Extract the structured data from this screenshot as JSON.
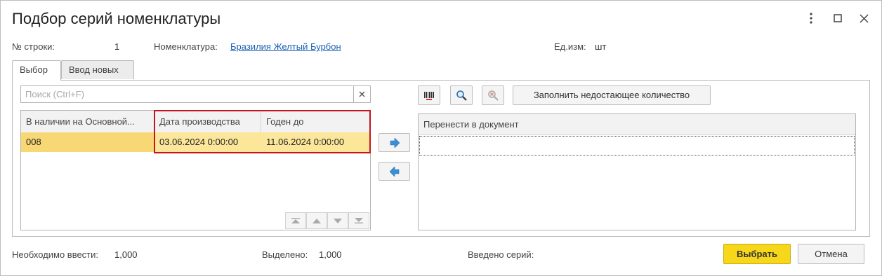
{
  "window": {
    "title": "Подбор серий номенклатуры",
    "menu_icon": "more-vertical-icon",
    "maximize_icon": "maximize-icon",
    "close_icon": "close-icon"
  },
  "header": {
    "row_label": "№ строки:",
    "row_value": "1",
    "item_label": "Номенклатура:",
    "item_value": "Бразилия Желтый Бурбон",
    "unit_label": "Ед.изм:",
    "unit_value": "шт"
  },
  "tabs": [
    {
      "label": "Выбор",
      "active": true
    },
    {
      "label": "Ввод новых",
      "active": false
    }
  ],
  "left": {
    "search": {
      "placeholder": "Поиск (Ctrl+F)",
      "value": ""
    },
    "columns": [
      "В наличии на Основной...",
      "Дата производства",
      "Годен до"
    ],
    "rows": [
      {
        "series": "008",
        "production_date": "03.06.2024 0:00:00",
        "expiry_date": "11.06.2024 0:00:00"
      }
    ]
  },
  "right": {
    "toolbar_icons": [
      "barcode-icon",
      "search-zoom-icon",
      "cancel-search-icon"
    ],
    "fill_button": "Заполнить недостающее количество",
    "column": "Перенести в документ"
  },
  "footer": {
    "required_label": "Необходимо ввести:",
    "required_value": "1,000",
    "selected_label": "Выделено:",
    "selected_value": "1,000",
    "entered_label": "Введено серий:",
    "entered_value": "",
    "ok_button": "Выбрать",
    "cancel_button": "Отмена"
  },
  "colors": {
    "selected_row": "#fbe69a",
    "primary_button": "#f7d71a",
    "highlight_border": "#c5161d",
    "link": "#1a5fb4",
    "arrow": "#3a8fd6"
  }
}
